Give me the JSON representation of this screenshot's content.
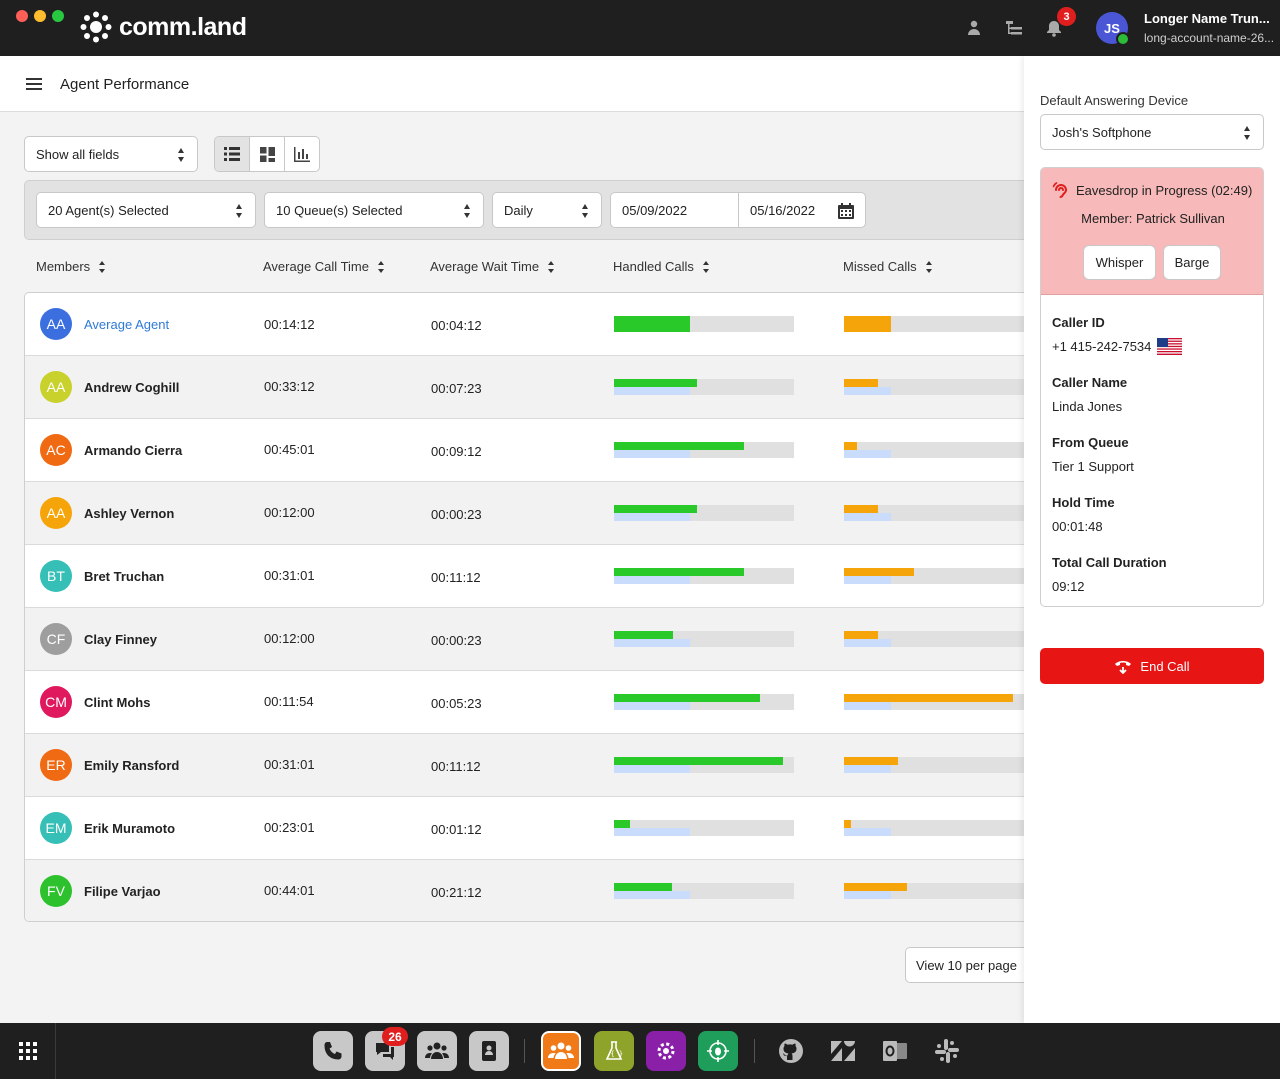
{
  "app": {
    "brand": "comm.land",
    "notifications_count": "3",
    "user": {
      "initials": "JS",
      "name": "Longer Name Trun...",
      "account": "long-account-name-26..."
    }
  },
  "page": {
    "title": "Agent  Performance"
  },
  "controls": {
    "fields_select": "Show all fields",
    "agents_select": "20 Agent(s) Selected",
    "queues_select": "10 Queue(s) Selected",
    "period_select": "Daily",
    "date_from": "05/09/2022",
    "date_to": "05/16/2022"
  },
  "table": {
    "columns": [
      "Members",
      "Average Call Time",
      "Average Wait Time",
      "Handled Calls",
      "Missed Calls"
    ],
    "rows": [
      {
        "initials": "AA",
        "name": "Average Agent",
        "avg_call": "00:14:12",
        "avg_wait": "00:04:12",
        "handled": 0.42,
        "handled_avg": null,
        "missed": 0.26,
        "missed_avg": null,
        "avatar_color": "#3b6fe0",
        "link": true
      },
      {
        "initials": "AA",
        "name": "Andrew Coghill",
        "avg_call": "00:33:12",
        "avg_wait": "00:07:23",
        "handled": 0.46,
        "handled_avg": 0.42,
        "missed": 0.19,
        "missed_avg": 0.26,
        "avatar_color": "#c9d12c"
      },
      {
        "initials": "AC",
        "name": "Armando Cierra",
        "avg_call": "00:45:01",
        "avg_wait": "00:09:12",
        "handled": 0.72,
        "handled_avg": 0.42,
        "missed": 0.07,
        "missed_avg": 0.26,
        "avatar_color": "#f06a14"
      },
      {
        "initials": "AA",
        "name": "Ashley Vernon",
        "avg_call": "00:12:00",
        "avg_wait": "00:00:23",
        "handled": 0.46,
        "handled_avg": 0.42,
        "missed": 0.19,
        "missed_avg": 0.26,
        "avatar_color": "#f5a50a"
      },
      {
        "initials": "BT",
        "name": "Bret Truchan",
        "avg_call": "00:31:01",
        "avg_wait": "00:11:12",
        "handled": 0.72,
        "handled_avg": 0.42,
        "missed": 0.39,
        "missed_avg": 0.26,
        "avatar_color": "#36bfb6"
      },
      {
        "initials": "CF",
        "name": "Clay Finney",
        "avg_call": "00:12:00",
        "avg_wait": "00:00:23",
        "handled": 0.33,
        "handled_avg": 0.42,
        "missed": 0.19,
        "missed_avg": 0.26,
        "avatar_color": "#9e9e9e"
      },
      {
        "initials": "CM",
        "name": "Clint Mohs",
        "avg_call": "00:11:54",
        "avg_wait": "00:05:23",
        "handled": 0.81,
        "handled_avg": 0.42,
        "missed": 0.94,
        "missed_avg": 0.26,
        "avatar_color": "#e0195f"
      },
      {
        "initials": "ER",
        "name": "Emily Ransford",
        "avg_call": "00:31:01",
        "avg_wait": "00:11:12",
        "handled": 0.94,
        "handled_avg": 0.42,
        "missed": 0.3,
        "missed_avg": 0.26,
        "avatar_color": "#f06a14"
      },
      {
        "initials": "EM",
        "name": "Erik Muramoto",
        "avg_call": "00:23:01",
        "avg_wait": "00:01:12",
        "handled": 0.09,
        "handled_avg": 0.42,
        "missed": 0.04,
        "missed_avg": 0.26,
        "avatar_color": "#36bfb6"
      },
      {
        "initials": "FV",
        "name": "Filipe Varjao",
        "avg_call": "00:44:01",
        "avg_wait": "00:21:12",
        "handled": 0.32,
        "handled_avg": 0.42,
        "missed": 0.35,
        "missed_avg": 0.26,
        "avatar_color": "#2dc22d"
      }
    ]
  },
  "pagination": {
    "per_page": "View 10 per page"
  },
  "panel": {
    "device_label": "Default Answering Device",
    "device_value": "Josh's Softphone",
    "eavesdrop_title": "Eavesdrop in Progress (02:49)",
    "member": "Member: Patrick Sullivan",
    "whisper": "Whisper",
    "barge": "Barge",
    "caller_id_label": "Caller ID",
    "caller_id": "+1 415-242-7534",
    "caller_name_label": "Caller Name",
    "caller_name": "Linda Jones",
    "from_queue_label": "From Queue",
    "from_queue": "Tier 1 Support",
    "hold_time_label": "Hold Time",
    "hold_time": "00:01:48",
    "total_duration_label": "Total Call Duration",
    "total_duration": "09:12",
    "end_call": "End Call"
  },
  "dock": {
    "messages_badge": "26"
  },
  "colors": {
    "handled_bar": "#28c928",
    "missed_bar": "#f5a50a",
    "average_bar": "#c9dcfb",
    "end_call": "#e81515",
    "eavesdrop_bg": "#f7b9b9"
  }
}
